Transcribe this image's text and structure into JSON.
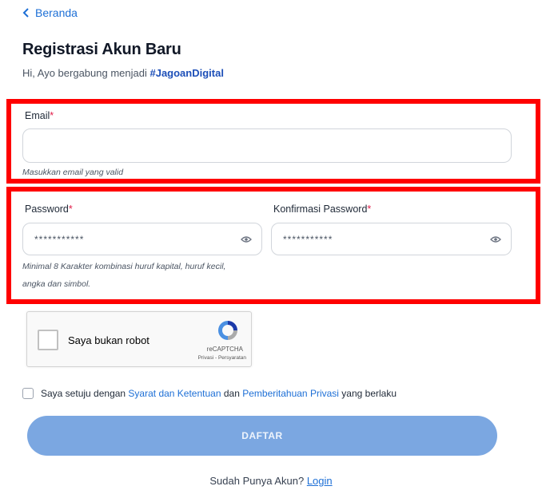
{
  "nav": {
    "back_label": "Beranda"
  },
  "header": {
    "title": "Registrasi Akun Baru",
    "subtitle_prefix": "Hi, Ayo bergabung menjadi ",
    "subtitle_hashtag": "#JagoanDigital"
  },
  "form": {
    "email": {
      "label": "Email",
      "required_mark": "*",
      "value": "",
      "placeholder": "",
      "hint": "Masukkan email yang valid"
    },
    "password": {
      "label": "Password",
      "required_mark": "*",
      "value": "***********",
      "hint_line1": "Minimal 8 Karakter kombinasi huruf kapital, huruf kecil,",
      "hint_line2": "angka dan simbol."
    },
    "confirm_password": {
      "label": "Konfirmasi Password",
      "required_mark": "*",
      "value": "***********"
    }
  },
  "captcha": {
    "label": "Saya bukan robot",
    "brand": "reCAPTCHA",
    "terms": "Privasi - Persyaratan"
  },
  "agreement": {
    "prefix": "Saya setuju dengan ",
    "terms_link": "Syarat dan Ketentuan",
    "middle": " dan ",
    "privacy_link": "Pemberitahuan Privasi",
    "suffix": " yang berlaku"
  },
  "submit": {
    "label": "DAFTAR"
  },
  "footer": {
    "prompt": "Sudah Punya Akun? ",
    "login_link": "Login"
  },
  "colors": {
    "link": "#1d6fd6",
    "button": "#7ba7e1",
    "highlight": "#ff0000",
    "required": "#e11d48"
  },
  "icons": {
    "back": "chevron-left-icon",
    "eye": "eye-icon",
    "recaptcha": "recaptcha-logo-icon"
  }
}
